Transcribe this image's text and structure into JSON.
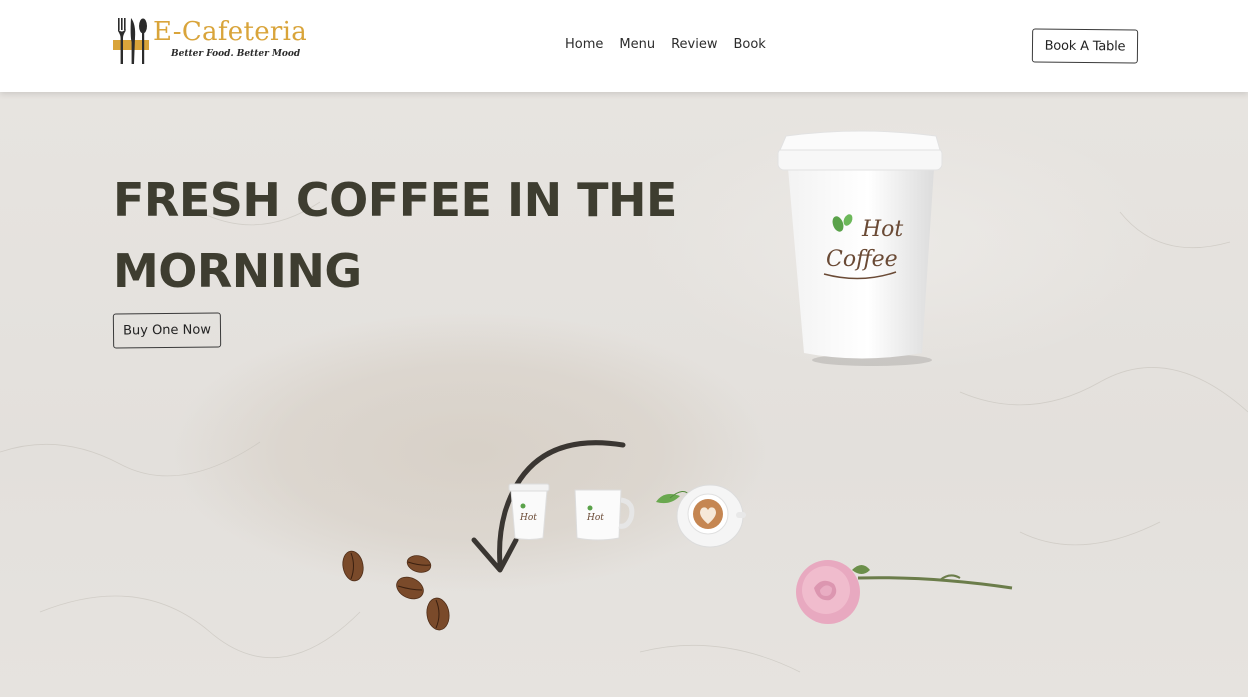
{
  "brand": {
    "name": "E-Cafeteria",
    "tagline": "Better Food. Better Mood"
  },
  "nav": {
    "items": [
      "Home",
      "Menu",
      "Review",
      "Book"
    ]
  },
  "header": {
    "cta_label": "Book A Table"
  },
  "hero": {
    "title_line1": "FRESH COFFEE IN THE",
    "title_line2": "MORNING",
    "cta_label": "Buy One Now",
    "cup_text_line1": "Hot",
    "cup_text_line2": "Coffee"
  },
  "colors": {
    "brand_gold": "#d9a43a",
    "heading": "#3e3d30",
    "background": "#e6e3df"
  },
  "icons": {
    "logo": "fork-knife-spoon-icon"
  }
}
